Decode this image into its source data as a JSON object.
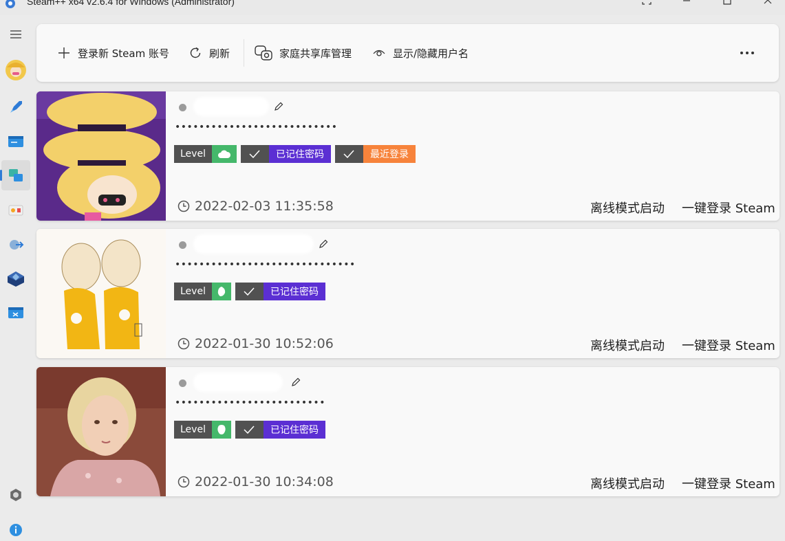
{
  "window": {
    "title": "Steam++ x64 v2.6.4 for Windows (Administrator)"
  },
  "sidebar": {
    "items": [
      {
        "name": "menu-icon"
      },
      {
        "name": "user-avatar"
      },
      {
        "name": "rocket-icon"
      },
      {
        "name": "script-icon"
      },
      {
        "name": "accounts-icon",
        "active": true
      },
      {
        "name": "library-icon"
      },
      {
        "name": "trade-icon"
      },
      {
        "name": "archive-icon"
      },
      {
        "name": "tools-icon"
      },
      {
        "name": "settings-icon"
      },
      {
        "name": "info-icon"
      }
    ]
  },
  "toolbar": {
    "add_label": "登录新 Steam 账号",
    "refresh_label": "刷新",
    "family_label": "家庭共享库管理",
    "toggle_label": "显示/隐藏用户名"
  },
  "accounts": [
    {
      "password": "•••••••••••••••••••••••••••",
      "level_label": "Level",
      "badge_remembered": "已记住密码",
      "badge_recent": "最近登录",
      "last_login": "2022-02-03 11:35:58",
      "offline_label": "离线模式启动",
      "login_label": "一键登录 Steam"
    },
    {
      "password": "••••••••••••••••••••••••••••••",
      "level_label": "Level",
      "badge_remembered": "已记住密码",
      "last_login": "2022-01-30 10:52:06",
      "offline_label": "离线模式启动",
      "login_label": "一键登录 Steam"
    },
    {
      "password": "•••••••••••••••••••••••••",
      "level_label": "Level",
      "badge_remembered": "已记住密码",
      "last_login": "2022-01-30 10:34:08",
      "offline_label": "离线模式启动",
      "login_label": "一键登录 Steam"
    }
  ],
  "colors": {
    "accent": "#2e7bd6",
    "level_green": "#45b86b",
    "remembered_purple": "#5b2fd3",
    "recent_orange": "#f7833b",
    "badge_dark": "#515151"
  }
}
